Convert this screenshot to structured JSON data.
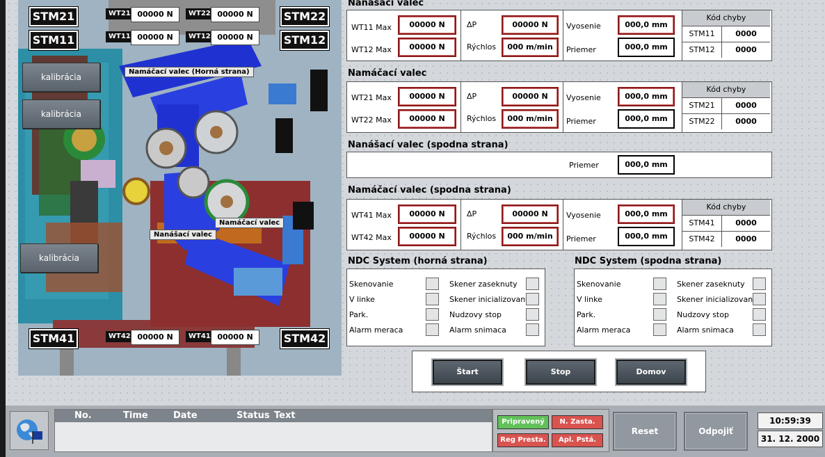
{
  "machine": {
    "stm_tags": {
      "stm21": "STM21",
      "stm22": "STM22",
      "stm11": "STM11",
      "stm12": "STM12",
      "stm41": "STM41",
      "stm42": "STM42"
    },
    "wt_labels": {
      "wt21": "WT21",
      "wt22": "WT22",
      "wt11": "WT11",
      "wt12": "WT12",
      "wt42": "WT42",
      "wt41": "WT41"
    },
    "wt_values": {
      "wt21": "00000 N",
      "wt22": "00000 N",
      "wt11": "00000 N",
      "wt12": "00000 N",
      "wt42": "00000 N",
      "wt41": "00000 N"
    },
    "calibration_buttons": [
      "kalibrácia",
      "kalibrácia",
      "kalibrácia"
    ],
    "callouts": {
      "top": "Namáčací valec (Horná strana)",
      "mid": "Namáčací valec",
      "low": "Nanášací valec"
    }
  },
  "sections": [
    {
      "title": "Nanášací valec",
      "wt_a": "WT11 Max",
      "wt_a_val": "00000 N",
      "wt_b": "WT12 Max",
      "wt_b_val": "00000 N",
      "dp": "ΔP",
      "dp_val": "00000 N",
      "speed": "Rýchlos",
      "speed_val": "000 m/min",
      "height": "Vyosenie",
      "height_val": "000,0 mm",
      "diameter": "Priemer",
      "diameter_val": "000,0 mm",
      "err_head": "Kód chyby",
      "err_rows": [
        [
          "STM11",
          "0000"
        ],
        [
          "STM12",
          "0000"
        ]
      ]
    },
    {
      "title": "Namáčací valec",
      "wt_a": "WT21 Max",
      "wt_a_val": "00000 N",
      "wt_b": "WT22 Max",
      "wt_b_val": "00000 N",
      "dp": "ΔP",
      "dp_val": "00000 N",
      "speed": "Rýchlos",
      "speed_val": "000 m/min",
      "height": "Vyosenie",
      "height_val": "000,0 mm",
      "diameter": "Priemer",
      "diameter_val": "000,0 mm",
      "err_head": "Kód chyby",
      "err_rows": [
        [
          "STM21",
          "0000"
        ],
        [
          "STM22",
          "0000"
        ]
      ]
    },
    {
      "title": "Namáčací valec (spodna strana)",
      "wt_a": "WT41 Max",
      "wt_a_val": "00000 N",
      "wt_b": "WT42 Max",
      "wt_b_val": "00000 N",
      "dp": "ΔP",
      "dp_val": "00000 N",
      "speed": "Rýchlos",
      "speed_val": "000 m/min",
      "height": "Vyosenie",
      "height_val": "000,0 mm",
      "diameter": "Priemer",
      "diameter_val": "000,0 mm",
      "err_head": "Kód chyby",
      "err_rows": [
        [
          "STM41",
          "0000"
        ],
        [
          "STM42",
          "0000"
        ]
      ]
    }
  ],
  "bottom_roller": {
    "title": "Nanášací valec (spodna strana)",
    "diameter": "Priemer",
    "diameter_val": "000,0 mm"
  },
  "ndc": [
    {
      "title": "NDC System (horná strana)",
      "left": [
        "Skenovanie",
        "V linke",
        "Park.",
        "Alarm meraca"
      ],
      "right": [
        "Skener zaseknuty",
        "Skener inicializovany",
        "Nudzovy stop",
        "Alarm snimaca"
      ]
    },
    {
      "title": "NDC System (spodna strana)",
      "left": [
        "Skenovanie",
        "V linke",
        "Park.",
        "Alarm meraca"
      ],
      "right": [
        "Skener zaseknuty",
        "Skener inicializovany",
        "Nudzovy stop",
        "Alarm snimaca"
      ]
    }
  ],
  "controls": {
    "start": "Štart",
    "stop": "Stop",
    "home": "Domov"
  },
  "alarm_list": {
    "no": "No.",
    "time": "Time",
    "date": "Date",
    "status": "Status",
    "text": "Text"
  },
  "status": {
    "ready": "Pripravený",
    "n_stop": "N. Zasta.",
    "reg_prest": "Reg Presta.",
    "apl_prest": "Apl. Pstá."
  },
  "bottom_buttons": {
    "reset": "Reset",
    "disconnect": "Odpojiť"
  },
  "clock": {
    "time": "10:59:39",
    "date": "31. 12. 2000"
  },
  "colors": {
    "ready": "#62c15a",
    "alarm": "#d9534f",
    "frame_red": "#8b1a1a"
  }
}
